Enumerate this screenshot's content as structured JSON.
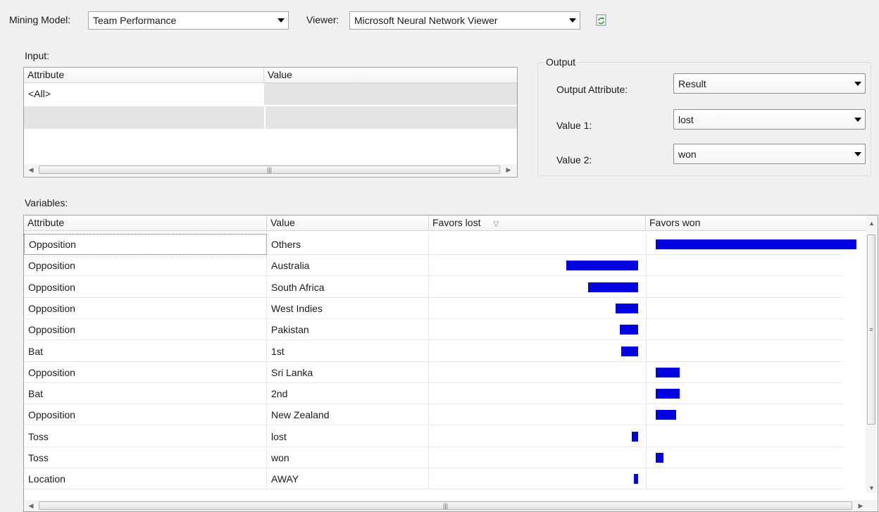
{
  "toolbar": {
    "mining_model_label": "Mining Model:",
    "mining_model_value": "Team Performance",
    "viewer_label": "Viewer:",
    "viewer_value": "Microsoft Neural Network Viewer"
  },
  "input": {
    "label": "Input:",
    "columns": [
      "Attribute",
      "Value"
    ],
    "rows": [
      {
        "attribute": "<All>",
        "value": ""
      },
      {
        "attribute": "",
        "value": ""
      }
    ]
  },
  "output": {
    "title": "Output",
    "output_attribute_label": "Output Attribute:",
    "output_attribute_value": "Result",
    "value1_label": "Value 1:",
    "value1": "lost",
    "value2_label": "Value 2:",
    "value2": "won"
  },
  "variables": {
    "label": "Variables:",
    "columns": [
      "Attribute",
      "Value",
      "Favors lost",
      "Favors won"
    ],
    "rows": [
      {
        "attribute": "Opposition",
        "value": "Others",
        "favors": "won",
        "score": 1.0
      },
      {
        "attribute": "Opposition",
        "value": "Australia",
        "favors": "lost",
        "score": 0.6
      },
      {
        "attribute": "Opposition",
        "value": "South Africa",
        "favors": "lost",
        "score": 0.42
      },
      {
        "attribute": "Opposition",
        "value": "West Indies",
        "favors": "lost",
        "score": 0.19
      },
      {
        "attribute": "Opposition",
        "value": "Pakistan",
        "favors": "lost",
        "score": 0.15
      },
      {
        "attribute": "Bat",
        "value": "1st",
        "favors": "lost",
        "score": 0.14
      },
      {
        "attribute": "Opposition",
        "value": "Sri Lanka",
        "favors": "won",
        "score": 0.12
      },
      {
        "attribute": "Bat",
        "value": "2nd",
        "favors": "won",
        "score": 0.12
      },
      {
        "attribute": "Opposition",
        "value": "New Zealand",
        "favors": "won",
        "score": 0.1
      },
      {
        "attribute": "Toss",
        "value": "lost",
        "favors": "lost",
        "score": 0.05
      },
      {
        "attribute": "Toss",
        "value": "won",
        "favors": "won",
        "score": 0.04
      },
      {
        "attribute": "Location",
        "value": "AWAY",
        "favors": "lost",
        "score": 0.03
      }
    ]
  },
  "colors": {
    "bar": "#0000e0"
  }
}
